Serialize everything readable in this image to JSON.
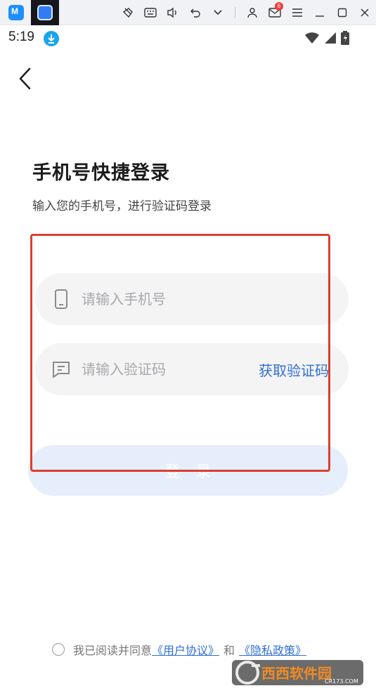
{
  "host_toolbar": {
    "mail_badge": "6"
  },
  "status_bar": {
    "time": "5:19"
  },
  "page": {
    "title": "手机号快捷登录",
    "subtitle": "输入您的手机号，进行验证码登录"
  },
  "form": {
    "phone_placeholder": "请输入手机号",
    "phone_value": "",
    "code_placeholder": "请输入验证码",
    "code_value": "",
    "get_code_label": "获取验证码",
    "login_label": "登录"
  },
  "agreement": {
    "prefix": "我已阅读并同意",
    "user_agreement": "《用户协议》",
    "conjunction": "和",
    "privacy_policy": "《隐私政策》",
    "checked": false
  },
  "watermark": {
    "brand": "西西软件园",
    "site": "CR173.COM"
  },
  "colors": {
    "accent": "#2f6fd6",
    "field_bg": "#f4f4f5",
    "login_bg": "#e6eefc",
    "annotation": "#d9412f"
  },
  "icons": [
    "back-chevron-icon",
    "phone-icon",
    "message-icon",
    "wifi-icon",
    "signal-icon",
    "battery-icon",
    "download-icon"
  ]
}
